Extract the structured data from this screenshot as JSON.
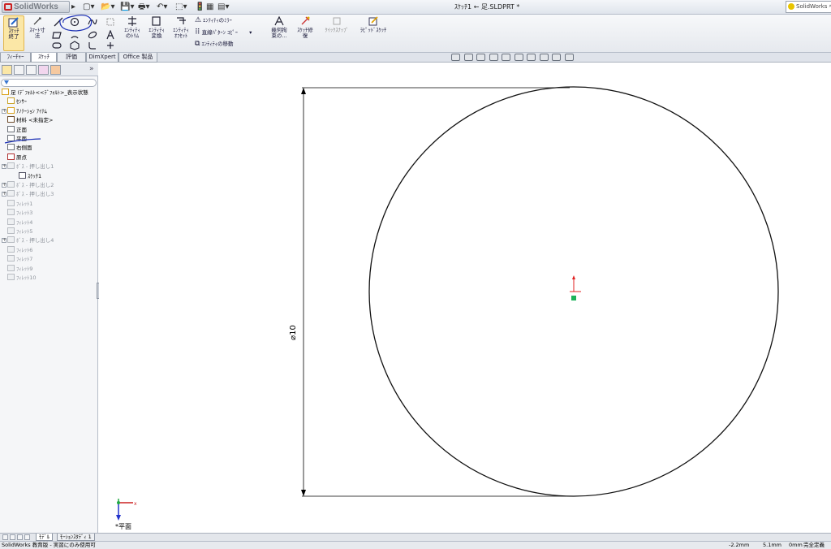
{
  "titlebar": {
    "app_name": "SolidWorks",
    "document_title": "ｽｹｯﾁ1 ← 足.SLDPRT *",
    "help_search": "SolidWorks ﾍﾙﾌﾟ"
  },
  "commands": {
    "sketch_exit": "ｽｹｯﾁ\n終了",
    "smart_dim": "ｽﾏｰﾄ寸\n法",
    "trim": "ｴﾝﾃｨﾃｨ\nのﾄﾘﾑ",
    "convert": "ｴﾝﾃｨﾃｨ\n変換",
    "offset": "ｴﾝﾃｨﾃｨ\nｵﾌｾｯﾄ",
    "mirror": "ｴﾝﾃｨﾃｨのﾐﾗｰ",
    "linear_pattern": "直線ﾊﾟﾀｰﾝ ｺﾋﾟｰ",
    "move": "ｴﾝﾃｨﾃｨの移動",
    "relations": "幾何拘\n束の...",
    "repair": "ｽｹｯﾁ修\n復",
    "quick_snap": "ｸｲｯｸｽﾅｯﾌﾟ",
    "rapid_sketch": "ﾗﾋﾟｯﾄﾞｽｹｯﾁ"
  },
  "tabs": [
    {
      "label": "ﾌｨｰﾁｬｰ",
      "active": false
    },
    {
      "label": "ｽｹｯﾁ",
      "active": true
    },
    {
      "label": "評価",
      "active": false
    },
    {
      "label": "DimXpert",
      "active": false
    },
    {
      "label": "Office 製品",
      "active": false
    }
  ],
  "tree": [
    {
      "label": "足 (ﾃﾞﾌｫﾙﾄ<<ﾃﾞﾌｫﾙﾄ>_表示状態",
      "dim": false,
      "indent": 0,
      "exp": false
    },
    {
      "label": "ｾﾝｻｰ",
      "dim": false,
      "indent": 1,
      "exp": false
    },
    {
      "label": "ｱﾉﾃｰｼｮﾝ ｱｲﾃﾑ",
      "dim": false,
      "indent": 1,
      "exp": true
    },
    {
      "label": "材料 <未指定>",
      "dim": false,
      "indent": 1,
      "exp": false
    },
    {
      "label": "正面",
      "dim": false,
      "indent": 1,
      "exp": false
    },
    {
      "label": "平面",
      "dim": false,
      "indent": 1,
      "exp": false
    },
    {
      "label": "右側面",
      "dim": false,
      "indent": 1,
      "exp": false
    },
    {
      "label": "原点",
      "dim": false,
      "indent": 1,
      "exp": false
    },
    {
      "label": "ﾎﾞｽ - 押し出し1",
      "dim": true,
      "indent": 1,
      "exp": true
    },
    {
      "label": "ｽｹｯﾁ1",
      "dim": false,
      "indent": 2,
      "exp": false
    },
    {
      "label": "ﾎﾞｽ - 押し出し2",
      "dim": true,
      "indent": 1,
      "exp": true
    },
    {
      "label": "ﾎﾞｽ - 押し出し3",
      "dim": true,
      "indent": 1,
      "exp": true
    },
    {
      "label": "ﾌｨﾚｯﾄ1",
      "dim": true,
      "indent": 1,
      "exp": false
    },
    {
      "label": "ﾌｨﾚｯﾄ3",
      "dim": true,
      "indent": 1,
      "exp": false
    },
    {
      "label": "ﾌｨﾚｯﾄ4",
      "dim": true,
      "indent": 1,
      "exp": false
    },
    {
      "label": "ﾌｨﾚｯﾄ5",
      "dim": true,
      "indent": 1,
      "exp": false
    },
    {
      "label": "ﾎﾞｽ - 押し出し4",
      "dim": true,
      "indent": 1,
      "exp": true
    },
    {
      "label": "ﾌｨﾚｯﾄ6",
      "dim": true,
      "indent": 1,
      "exp": false
    },
    {
      "label": "ﾌｨﾚｯﾄ7",
      "dim": true,
      "indent": 1,
      "exp": false
    },
    {
      "label": "ﾌｨﾚｯﾄ9",
      "dim": true,
      "indent": 1,
      "exp": false
    },
    {
      "label": "ﾌｨﾚｯﾄ10",
      "dim": true,
      "indent": 1,
      "exp": false
    }
  ],
  "graphics": {
    "dimension_text": "⌀10",
    "triad_label": "*平面"
  },
  "bottom_tabs": [
    "ﾓﾃﾞﾙ",
    "ﾓｰｼｮﾝｽﾀﾃﾞｨ 1"
  ],
  "status": {
    "message": "SolidWorks 教育版 - 実習にのみ使用可",
    "x": "-2.2mm",
    "y": "5.1mm",
    "z": "0mm",
    "state": "完全定義"
  },
  "colors": {
    "accent": "#3a77d0",
    "annotation_ink": "#1b2fb5",
    "origin_red": "#e02020",
    "origin_green": "#1db35a"
  }
}
